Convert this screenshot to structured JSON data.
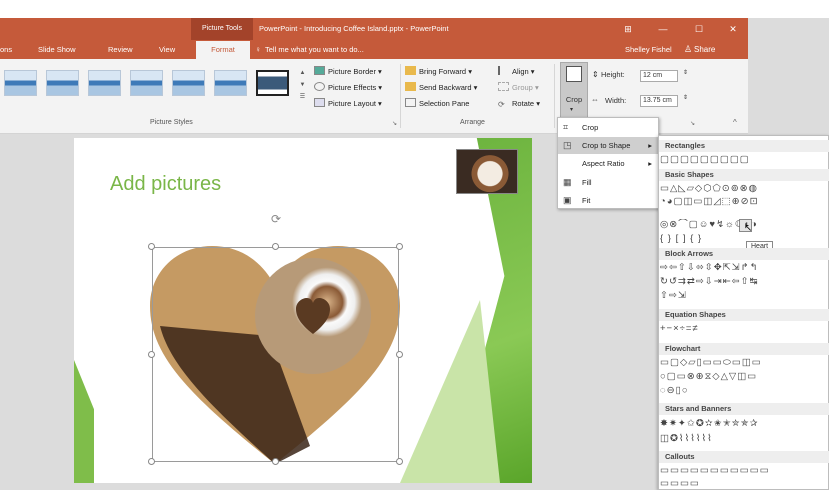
{
  "window": {
    "context_tab": "Picture Tools",
    "title": "PowerPoint - Introducing Coffee Island.pptx - PowerPoint",
    "controls": [
      "⊞",
      "—",
      "☐",
      "✕"
    ]
  },
  "tabs": {
    "items": [
      "ons",
      "Slide Show",
      "Review",
      "View"
    ],
    "active": "Format",
    "tellme": "Tell me what you want to do...",
    "user": "Shelley Fishel",
    "share": "Share"
  },
  "ribbon": {
    "picture_border": "Picture Border",
    "picture_effects": "Picture Effects",
    "picture_layout": "Picture Layout",
    "picture_styles_label": "Picture Styles",
    "bring_forward": "Bring Forward",
    "send_backward": "Send Backward",
    "selection_pane": "Selection Pane",
    "align": "Align",
    "group": "Group",
    "rotate": "Rotate",
    "arrange_label": "Arrange",
    "crop": "Crop",
    "height_label": "Height:",
    "height_value": "12 cm",
    "width_label": "Width:",
    "width_value": "13.75 cm"
  },
  "slide": {
    "title": "Add pictures"
  },
  "crop_menu": {
    "items": [
      "Crop",
      "Crop to Shape",
      "Aspect Ratio",
      "Fill",
      "Fit"
    ]
  },
  "shapes_gallery": {
    "sections": [
      {
        "title": "Rectangles",
        "rows": [
          "▢▢▢▢▢▢▢▢▢"
        ]
      },
      {
        "title": "Basic Shapes",
        "rows": [
          "▭△◺▱◇⬡⬠⊙⊚⊗◍",
          "◔◕▢◫▭◫◿⬚⊕⊘⊡",
          "◎⊗⌒▢☺♥↯☼☾◐◑",
          "{ } [ ] { }"
        ]
      },
      {
        "title": "Block Arrows",
        "rows": [
          "⇨⇦⇧⇩⬄⇳✥⇱⇲↱↰",
          "↻↺⇉⇄⇨⇩⇥⇤⇦⇧↹",
          "⇧⇨⇲"
        ]
      },
      {
        "title": "Equation Shapes",
        "rows": [
          "+−×÷=≠"
        ]
      },
      {
        "title": "Flowchart",
        "rows": [
          "▭▢◇▱▯▭▭⬭▭◫▭",
          "○▢▭⊗⊕⧖◇△▽◫▭",
          "◌⊖▯○"
        ]
      },
      {
        "title": "Stars and Banners",
        "rows": [
          "✸✷✦✩✪✫✬✭✮✯✰",
          "◫✪⌇⌇⌇⌇⌇⌇"
        ]
      },
      {
        "title": "Callouts",
        "rows": [
          "▭▭▭▭▭▭▭▭▭▭▭",
          "▭▭▭▭"
        ]
      }
    ],
    "tooltip": "Heart"
  }
}
